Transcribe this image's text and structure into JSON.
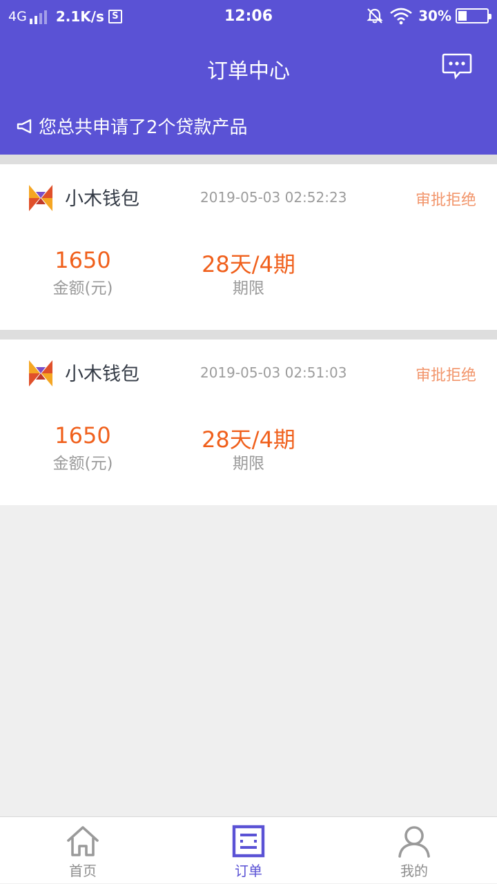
{
  "status_bar": {
    "network": "4G",
    "speed": "2.1K/s",
    "s_icon": "S",
    "time": "12:06",
    "battery_pct": "30%",
    "battery_level": 0.3
  },
  "header": {
    "title": "订单中心",
    "notice": "您总共申请了2个贷款产品"
  },
  "orders": [
    {
      "product": "小木钱包",
      "time": "2019-05-03 02:52:23",
      "status": "审批拒绝",
      "amount": "1650",
      "amount_label": "金额(元)",
      "term": "28天/4期",
      "term_label": "期限"
    },
    {
      "product": "小木钱包",
      "time": "2019-05-03 02:51:03",
      "status": "审批拒绝",
      "amount": "1650",
      "amount_label": "金额(元)",
      "term": "28天/4期",
      "term_label": "期限"
    }
  ],
  "tabbar": {
    "items": [
      {
        "label": "首页",
        "icon": "home-icon"
      },
      {
        "label": "订单",
        "icon": "order-list-icon",
        "active": true
      },
      {
        "label": "我的",
        "icon": "user-icon"
      }
    ]
  },
  "colors": {
    "brand": "#5a52d5",
    "amount": "#f0601c",
    "status": "#f2956b",
    "background": "#efefef"
  }
}
